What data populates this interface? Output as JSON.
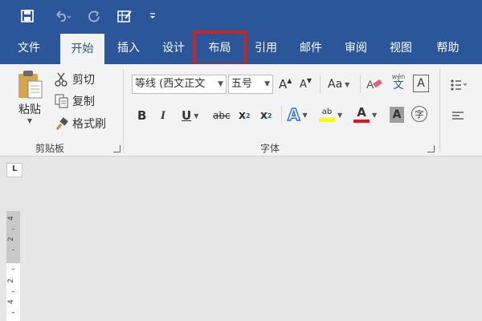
{
  "app": {
    "tabs": [
      "文件",
      "开始",
      "插入",
      "设计",
      "布局",
      "引用",
      "邮件",
      "审阅",
      "视图",
      "帮助"
    ],
    "active_tab": "开始",
    "highlighted_tab": "布局"
  },
  "clipboard": {
    "paste_label": "粘贴",
    "cut_label": "剪切",
    "copy_label": "复制",
    "format_painter_label": "格式刷",
    "group_label": "剪贴板"
  },
  "font": {
    "font_name": "等线 (西文正文",
    "font_size": "五号",
    "group_label": "字体",
    "grow_label": "A",
    "shrink_label": "A",
    "case_label": "Aa",
    "phonetic_top": "wén",
    "phonetic_bottom": "文",
    "border_char": "A",
    "bold": "B",
    "italic": "I",
    "underline": "U",
    "strike": "abc",
    "subscript_base": "x",
    "subscript_mark": "2",
    "superscript_base": "x",
    "superscript_mark": "2",
    "text_effects": "A",
    "highlight_text": "ab",
    "font_color": "A",
    "char_shading": "A",
    "enclose_char": "字"
  },
  "ruler": {
    "corner_mark": "L",
    "numbers": [
      "4",
      "2",
      "2",
      "4"
    ]
  },
  "colors": {
    "ribbon_blue": "#2b579a",
    "highlight_red": "#c0282e",
    "font_color_red": "#e81123",
    "highlighter_yellow": "#ffff00"
  }
}
